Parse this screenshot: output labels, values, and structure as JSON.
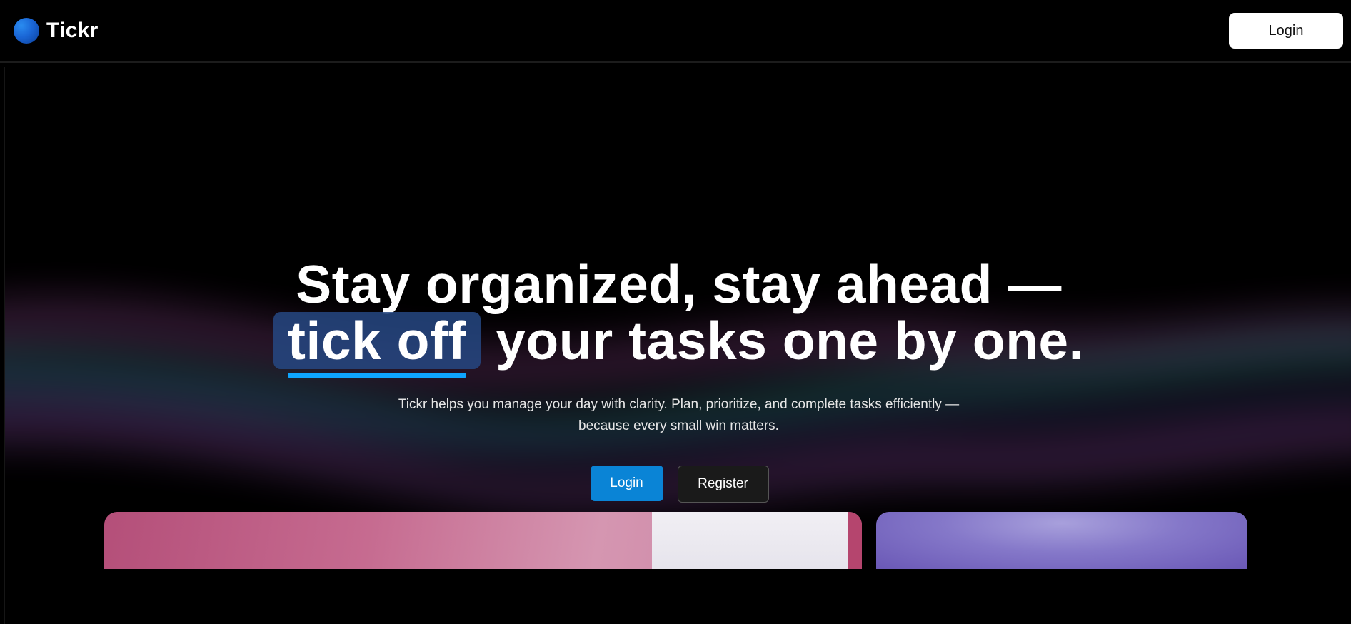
{
  "navbar": {
    "brand_name": "Tickr",
    "logo_icon": "circle-gradient-logo",
    "login_label": "Login"
  },
  "hero": {
    "title_line1": "Stay organized, stay ahead —",
    "title_highlight": "tick off",
    "title_line2_rest": "your tasks one by one.",
    "subtitle_line1": "Tickr helps you manage your day with clarity. Plan, prioritize, and complete tasks efficiently —",
    "subtitle_line2": "because every small win matters.",
    "login_label": "Login",
    "register_label": "Register"
  },
  "colors": {
    "accent": "#0a84d6",
    "highlight_underline": "#0ea5ff",
    "background": "#000000"
  }
}
